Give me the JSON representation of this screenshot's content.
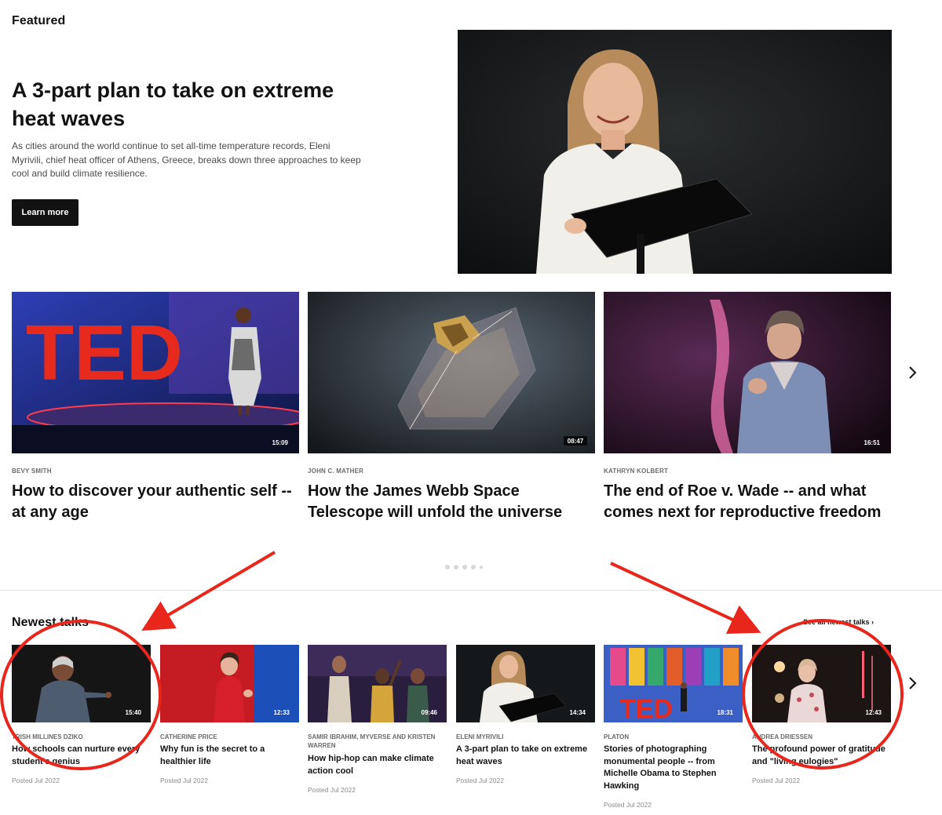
{
  "featured": {
    "section_label": "Featured",
    "title": "A 3-part plan to take on extreme heat waves",
    "description": "As cities around the world continue to set all-time temperature records, Eleni Myrivili, chief heat officer of Athens, Greece, breaks down three approaches to keep cool and build climate resilience.",
    "cta_label": "Learn more"
  },
  "carousel": {
    "cards": [
      {
        "speaker": "BEVY SMITH",
        "title": "How to discover your authentic self -- at any age",
        "duration": "15:09"
      },
      {
        "speaker": "JOHN C. MATHER",
        "title": "How the James Webb Space Telescope will unfold the universe",
        "duration": "08:47"
      },
      {
        "speaker": "KATHRYN KOLBERT",
        "title": "The end of Roe v. Wade -- and what comes next for reproductive freedom",
        "duration": "16:51"
      }
    ],
    "next_icon": "chevron-right-icon"
  },
  "newest": {
    "section_label": "Newest talks",
    "see_all_label": "See all newest talks",
    "talks": [
      {
        "speaker": "TRISH MILLINES DZIKO",
        "title": "How schools can nurture every student's genius",
        "duration": "15:40",
        "date": "Posted Jul 2022"
      },
      {
        "speaker": "CATHERINE PRICE",
        "title": "Why fun is the secret to a healthier life",
        "duration": "12:33",
        "date": "Posted Jul 2022"
      },
      {
        "speaker": "SAMIR IBRAHIM, MYVERSE AND KRISTEN WARREN",
        "title": "How hip-hop can make climate action cool",
        "duration": "09:46",
        "date": "Posted Jul 2022"
      },
      {
        "speaker": "ELENI MYRIVILI",
        "title": "A 3-part plan to take on extreme heat waves",
        "duration": "14:34",
        "date": "Posted Jul 2022"
      },
      {
        "speaker": "PLATON",
        "title": "Stories of photographing monumental people -- from Michelle Obama to Stephen Hawking",
        "duration": "18:31",
        "date": "Posted Jul 2022"
      },
      {
        "speaker": "ANDREA DRIESSEN",
        "title": "The profound power of gratitude and \"living eulogies\"",
        "duration": "12:43",
        "date": "Posted Jul 2022"
      }
    ]
  },
  "colors": {
    "accent": "#e62b1e",
    "dark": "#121212",
    "annotation": "#e8261c"
  }
}
